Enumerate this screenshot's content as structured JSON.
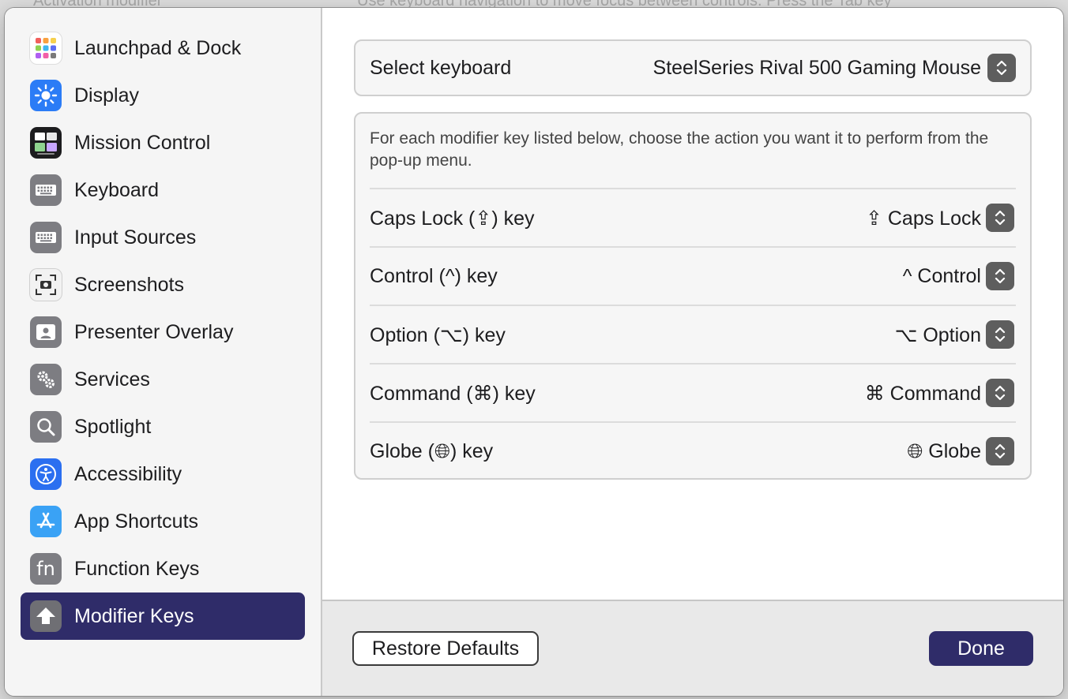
{
  "background": {
    "ghost_left": "Activation modifier",
    "ghost_right": "Use keyboard navigation to move focus between controls. Press the Tab key"
  },
  "sidebar": {
    "items": [
      {
        "label": "Launchpad & Dock",
        "icon": "launchpad-icon"
      },
      {
        "label": "Display",
        "icon": "display-icon"
      },
      {
        "label": "Mission Control",
        "icon": "mission-control-icon"
      },
      {
        "label": "Keyboard",
        "icon": "keyboard-icon"
      },
      {
        "label": "Input Sources",
        "icon": "input-sources-icon"
      },
      {
        "label": "Screenshots",
        "icon": "screenshots-icon"
      },
      {
        "label": "Presenter Overlay",
        "icon": "presenter-overlay-icon"
      },
      {
        "label": "Services",
        "icon": "services-icon"
      },
      {
        "label": "Spotlight",
        "icon": "spotlight-icon"
      },
      {
        "label": "Accessibility",
        "icon": "accessibility-icon"
      },
      {
        "label": "App Shortcuts",
        "icon": "app-shortcuts-icon"
      },
      {
        "label": "Function Keys",
        "icon": "function-keys-icon",
        "icon_text": "fn"
      },
      {
        "label": "Modifier Keys",
        "icon": "modifier-keys-icon",
        "selected": true
      }
    ]
  },
  "main": {
    "select_keyboard": {
      "label": "Select keyboard",
      "value": "SteelSeries Rival 500 Gaming Mouse"
    },
    "description": "For each modifier key listed below, choose the action you want it to perform from the pop-up menu.",
    "modifiers": [
      {
        "label": "Caps Lock (⇪) key",
        "value": "⇪ Caps Lock"
      },
      {
        "label": "Control (^) key",
        "value": "^ Control"
      },
      {
        "label": "Option (⌥) key",
        "value": "⌥ Option"
      },
      {
        "label": "Command (⌘) key",
        "value": "⌘ Command"
      },
      {
        "label": "Globe (🌐︎) key",
        "value": "🌐︎ Globe"
      }
    ]
  },
  "footer": {
    "restore_label": "Restore Defaults",
    "done_label": "Done"
  },
  "colors": {
    "accent": "#2f2c69",
    "sidebar_bg": "#f5f5f5",
    "card_bg": "#f6f6f6"
  }
}
